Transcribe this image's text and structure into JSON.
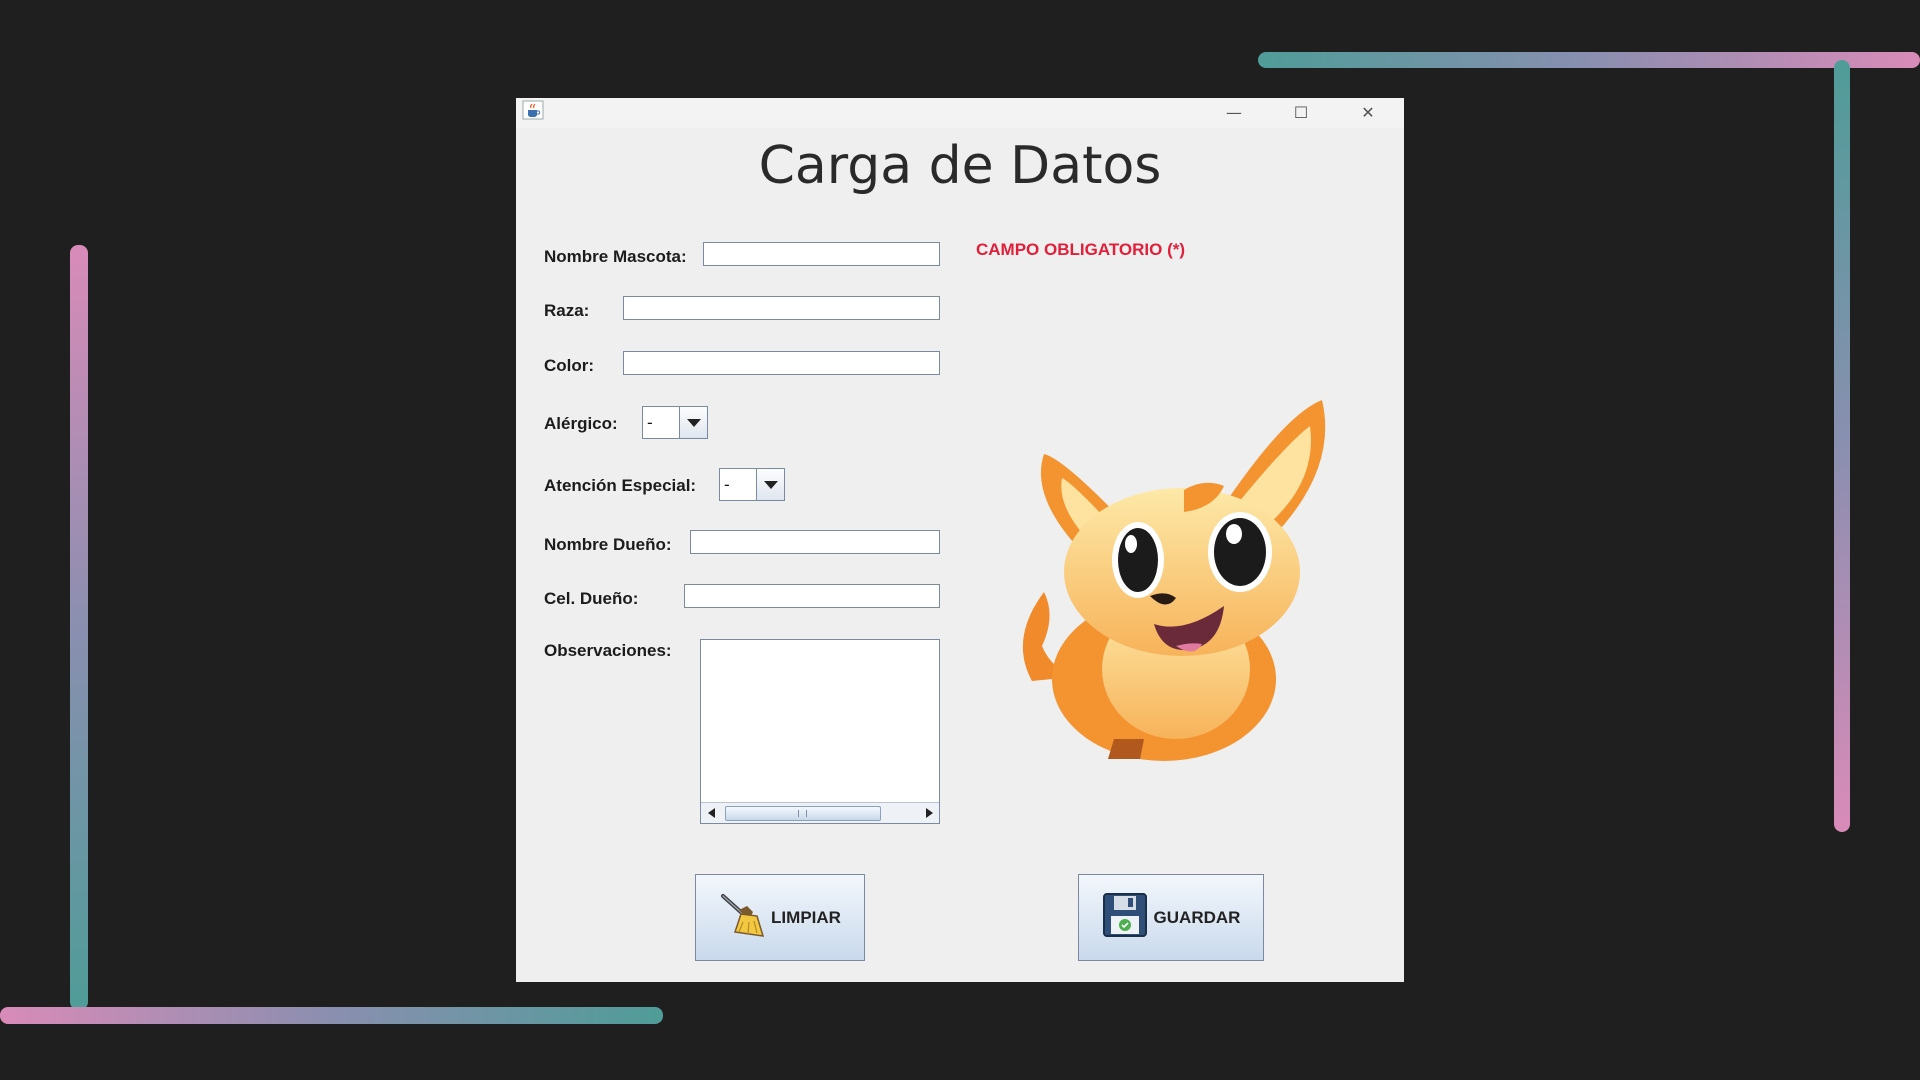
{
  "window": {
    "title": "Carga de Datos",
    "required_note": "CAMPO OBLIGATORIO (*)",
    "controls": {
      "minimize": "—",
      "maximize": "☐",
      "close": "✕"
    }
  },
  "form": {
    "nombre_mascota": {
      "label": "Nombre Mascota:",
      "value": ""
    },
    "raza": {
      "label": "Raza:",
      "value": ""
    },
    "color": {
      "label": "Color:",
      "value": ""
    },
    "alergico": {
      "label": "Alérgico:",
      "selected": "-"
    },
    "atencion_especial": {
      "label": "Atención Especial:",
      "selected": "-"
    },
    "nombre_dueno": {
      "label": "Nombre Dueño:",
      "value": ""
    },
    "cel_dueno": {
      "label": "Cel. Dueño:",
      "value": ""
    },
    "observaciones": {
      "label": "Observaciones:",
      "value": ""
    }
  },
  "buttons": {
    "limpiar": "LIMPIAR",
    "guardar": "GUARDAR"
  },
  "icons": {
    "app": "java-cup-icon",
    "limpiar": "broom-icon",
    "guardar": "floppy-disk-icon",
    "image": "cartoon-dog-mascot"
  },
  "colors": {
    "required_text": "#e0203a",
    "window_bg": "#efefef",
    "desktop_bg": "#1f1f1f",
    "accent_teal": "#4f9c98",
    "accent_pink": "#d98bb8"
  }
}
